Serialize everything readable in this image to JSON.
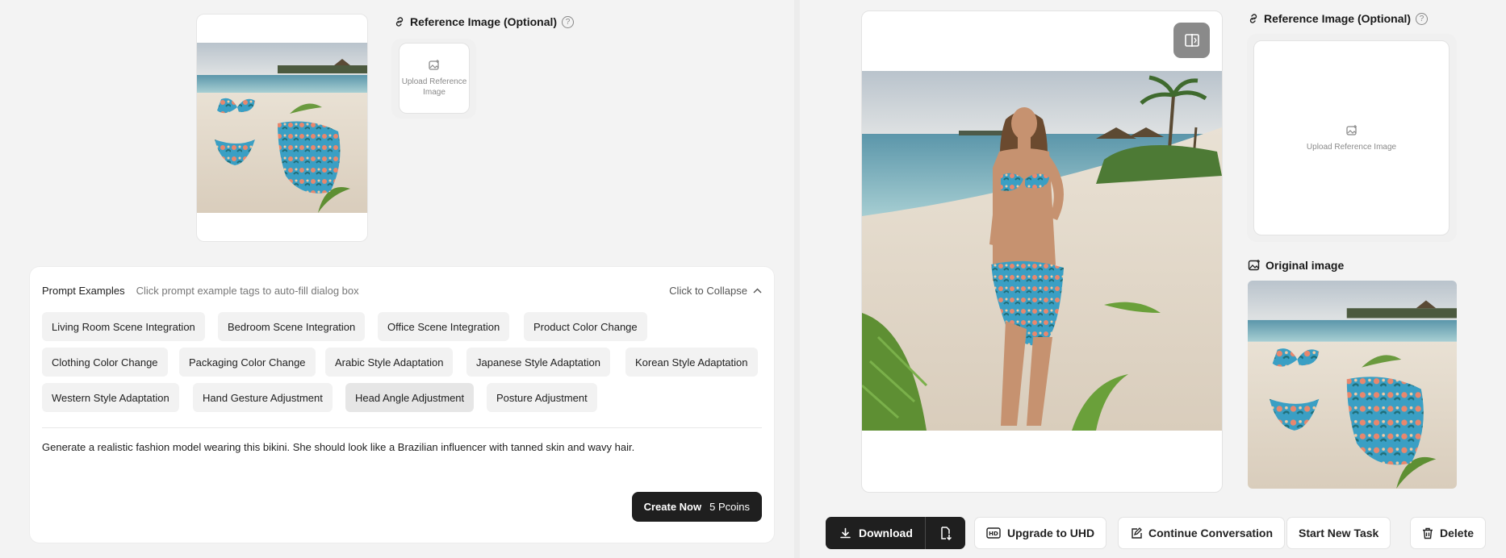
{
  "left": {
    "reference": {
      "label": "Reference Image (Optional)",
      "help": "?",
      "upload_text": "Upload Reference Image"
    },
    "prompt": {
      "title": "Prompt Examples",
      "hint": "Click prompt example tags to auto-fill dialog box",
      "collapse_label": "Click to Collapse",
      "tags": [
        "Living Room Scene Integration",
        "Bedroom Scene Integration",
        "Office Scene Integration",
        "Product Color Change",
        "Clothing Color Change",
        "Packaging Color Change",
        "Arabic Style Adaptation",
        "Japanese Style Adaptation",
        "Korean Style Adaptation",
        "Western Style Adaptation",
        "Hand Gesture Adjustment",
        "Head Angle Adjustment",
        "Posture Adjustment"
      ],
      "active_tag": "Head Angle Adjustment",
      "text": "Generate a realistic fashion model wearing this bikini. She should look like a Brazilian influencer with tanned skin and wavy hair.",
      "create_label": "Create Now",
      "create_cost": "5 Pcoins"
    }
  },
  "right": {
    "reference": {
      "label": "Reference Image (Optional)",
      "help": "?",
      "upload_text": "Upload Reference Image"
    },
    "original_label": "Original image",
    "actions": {
      "download": "Download",
      "upgrade": "Upgrade to UHD",
      "continue": "Continue Conversation",
      "new_task": "Start New Task",
      "delete": "Delete"
    }
  },
  "colors": {
    "accent_dark": "#1f1f1f",
    "sand": "#e8ded0",
    "sea": "#7eb7c4",
    "bikini": "#3a9fc4"
  }
}
